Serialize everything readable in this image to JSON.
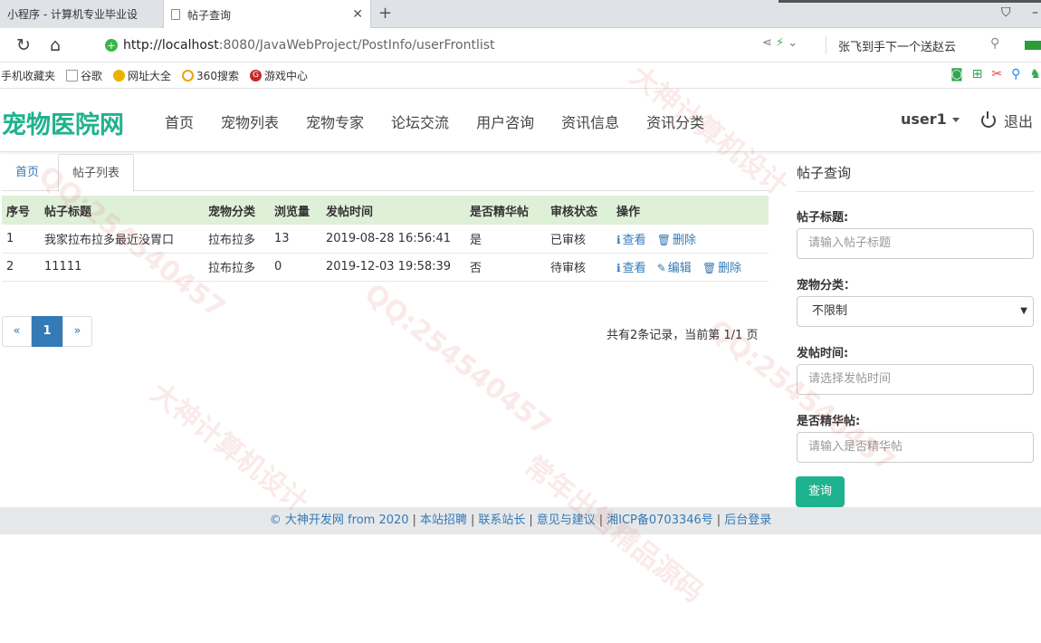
{
  "browser": {
    "tabs": [
      {
        "label": "小程序 - 计算机专业毕业设"
      },
      {
        "label": "帖子查询"
      }
    ],
    "new_tab": "+",
    "url_host": "http://localhost",
    "url_rest": ":8080/JavaWebProject/PostInfo/userFrontlist",
    "search_text": "张飞到手下一个送赵云",
    "bookmarks": [
      "手机收藏夹",
      "谷歌",
      "网址大全",
      "360搜索",
      "游戏中心"
    ]
  },
  "site": {
    "brand": "宠物医院网",
    "nav": [
      "首页",
      "宠物列表",
      "宠物专家",
      "论坛交流",
      "用户咨询",
      "资讯信息",
      "资讯分类"
    ],
    "user": "user1",
    "logout": "退出"
  },
  "content": {
    "tabs": [
      "首页",
      "帖子列表"
    ],
    "columns": [
      "序号",
      "帖子标题",
      "宠物分类",
      "浏览量",
      "发帖时间",
      "是否精华帖",
      "审核状态",
      "操作"
    ],
    "rows": [
      {
        "no": "1",
        "title": "我家拉布拉多最近没胃口",
        "category": "拉布拉多",
        "views": "13",
        "time": "2019-08-28 16:56:41",
        "featured": "是",
        "status": "已审核",
        "actions": [
          "查看",
          "删除"
        ]
      },
      {
        "no": "2",
        "title": "11111",
        "category": "拉布拉多",
        "views": "0",
        "time": "2019-12-03 19:58:39",
        "featured": "否",
        "status": "待审核",
        "actions": [
          "查看",
          "编辑",
          "删除"
        ]
      }
    ],
    "pager": {
      "prev": "«",
      "current": "1",
      "next": "»"
    },
    "page_info": "共有2条记录，当前第 1/1 页"
  },
  "sidebar": {
    "title": "帖子查询",
    "title_label": "帖子标题:",
    "title_placeholder": "请输入帖子标题",
    "category_label": "宠物分类：",
    "category_value": "不限制",
    "time_label": "发帖时间:",
    "time_placeholder": "请选择发帖时间",
    "featured_label": "是否精华帖:",
    "featured_placeholder": "请输入是否精华帖",
    "query_button": "查询"
  },
  "footer": {
    "links": [
      "© 大神开发网 from 2020",
      "本站招聘",
      "联系站长",
      "意见与建议",
      "湘ICP备0703346号",
      "后台登录"
    ]
  },
  "watermark": [
    "QQ:254540457",
    "大神计算机设计",
    "常年出售精品源码"
  ],
  "colors": {
    "brand": "#1fb28e",
    "link": "#337ab7",
    "table_header": "#dff0d8",
    "footer_bg": "#e6e8ea"
  }
}
